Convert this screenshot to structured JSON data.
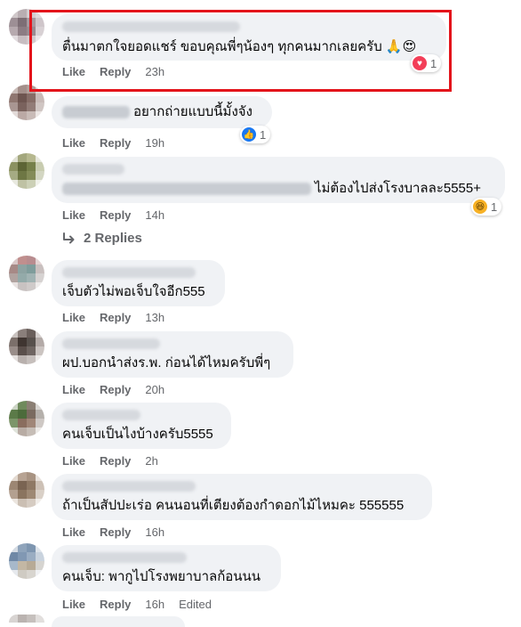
{
  "comments": [
    {
      "text": "ตื่นมาตกใจยอดแชร์ ขอบคุณพี่ๆน้องๆ ทุกคนมากเลยครับ",
      "emoji": "🙏😍",
      "actions": {
        "like": "Like",
        "reply": "Reply",
        "time": "23h"
      },
      "reaction": {
        "icon": "love-icon",
        "count": "1",
        "color": "#f33e58"
      }
    },
    {
      "text": "อยากถ่ายแบบนี้มั้งจัง",
      "actions": {
        "like": "Like",
        "reply": "Reply",
        "time": "19h"
      },
      "reaction": {
        "icon": "like-icon",
        "count": "1",
        "color": "#1877f2"
      }
    },
    {
      "text": "ไม่ต้องไปส่งโรงบาลละ5555+",
      "actions": {
        "like": "Like",
        "reply": "Reply",
        "time": "14h"
      },
      "reaction": {
        "icon": "haha-icon",
        "count": "1",
        "color": "#f7b125"
      },
      "replies": "2 Replies"
    },
    {
      "text": "เจ็บตัวไม่พอเจ็บใจอีก555",
      "actions": {
        "like": "Like",
        "reply": "Reply",
        "time": "13h"
      }
    },
    {
      "text": "ผป.บอกนำส่งร.พ. ก่อนได้ไหมครับพี่ๆ",
      "actions": {
        "like": "Like",
        "reply": "Reply",
        "time": "20h"
      }
    },
    {
      "text": "คนเจ็บเป็นไงบ้างครับ5555",
      "actions": {
        "like": "Like",
        "reply": "Reply",
        "time": "2h"
      }
    },
    {
      "text": "ถ้าเป็นสัปปะเร่อ คนนอนที่เตียงต้องกำดอกไม้ไหมคะ 555555",
      "actions": {
        "like": "Like",
        "reply": "Reply",
        "time": "16h"
      }
    },
    {
      "text": "คนเจ็บ: พากูไปโรงพยาบาลก้อนนน",
      "actions": {
        "like": "Like",
        "reply": "Reply",
        "time": "16h",
        "edited": "Edited"
      }
    }
  ],
  "colors": {
    "bubble": "#f0f2f5",
    "secondary_text": "#65676b",
    "highlight": "#e3141b"
  }
}
